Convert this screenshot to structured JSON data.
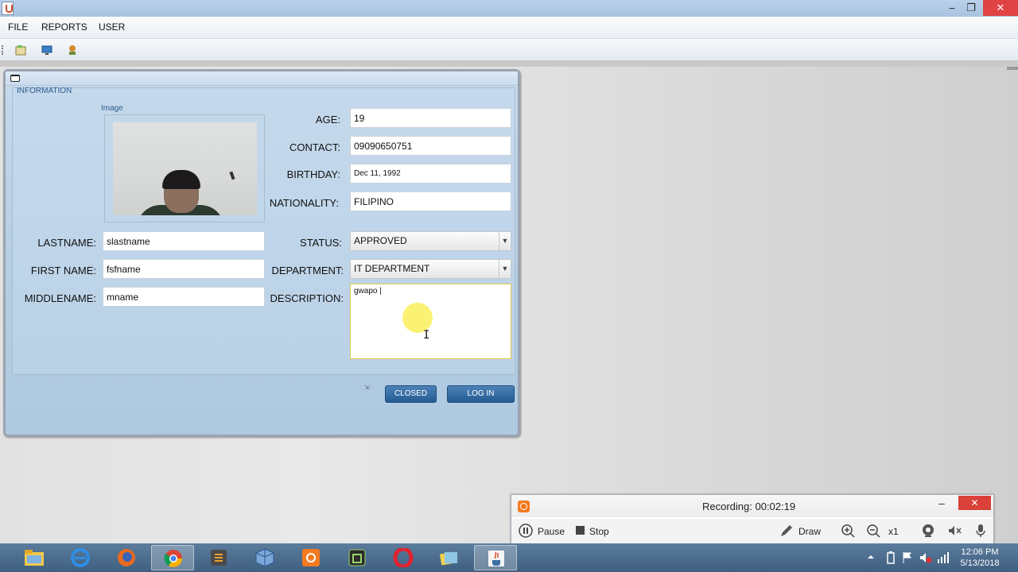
{
  "window": {
    "minimize": "–",
    "maximize": "❐",
    "close": "✕"
  },
  "menu": [
    "FILE",
    "REPORTS",
    "USER"
  ],
  "panel": {
    "title": "INFORMATION",
    "image_title": "Image"
  },
  "labels": {
    "age": "AGE:",
    "contact": "CONTACT:",
    "birthday": "BIRTHDAY:",
    "nationality": "NATIONALITY:",
    "lastname": "LASTNAME:",
    "firstname": "FIRST  NAME:",
    "middlename": "MIDDLENAME:",
    "status": "STATUS:",
    "department": "DEPARTMENT:",
    "description": "DESCRIPTION:"
  },
  "values": {
    "age": "19",
    "contact": "09090650751",
    "birthday": "Dec 11, 1992",
    "nationality": "FILIPINO",
    "lastname": "slastname",
    "firstname": "fsfname",
    "middlename": "mname",
    "status": "APPROVED",
    "department": "IT  DEPARTMENT",
    "description": "gwapo |"
  },
  "buttons": {
    "closed": "CLOSED",
    "login": "LOG IN"
  },
  "recorder": {
    "title": "Recording:  00:02:19",
    "pause": "Pause",
    "stop": "Stop",
    "draw": "Draw",
    "zoom": "x1",
    "minimize": "–",
    "close": "✕",
    "accent": "#f47a20"
  },
  "taskbar": {
    "apps": [
      "file-explorer-icon",
      "internet-explorer-icon",
      "firefox-icon",
      "chrome-icon",
      "sublime-text-icon",
      "virtualbox-icon",
      "recorder-icon",
      "device-icon",
      "opera-icon",
      "folder-notes-icon",
      "java-icon"
    ],
    "time": "12:06 PM",
    "date": "5/13/2018"
  },
  "colors": {
    "button": "#245b92",
    "panel": "#bad1e6",
    "close": "#e04343"
  }
}
